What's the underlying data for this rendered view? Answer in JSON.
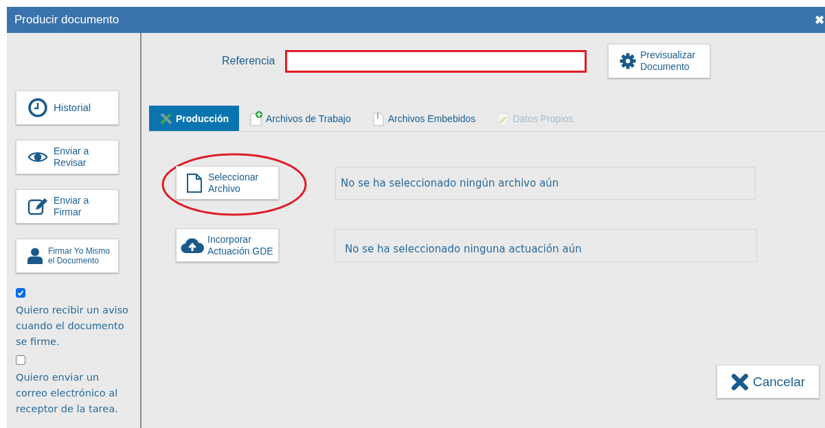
{
  "window": {
    "title": "Producir documento",
    "close": "✖"
  },
  "sidebar": {
    "buttons": [
      {
        "kind": "clock",
        "label": "Historial"
      },
      {
        "kind": "eye",
        "label": "Enviar a\nRevisar"
      },
      {
        "kind": "edit",
        "label": "Enviar a\nFirmar"
      },
      {
        "kind": "user",
        "label": "Firmar Yo Mismo\nel Documento"
      }
    ],
    "options": [
      {
        "checked": true,
        "label": "Quiero recibir un aviso cuando el documento se firme."
      },
      {
        "checked": false,
        "label": "Quiero enviar un correo electrónico al receptor de la tarea."
      }
    ]
  },
  "reference": {
    "label": "Referencia"
  },
  "preview_button": "Previsualizar\nDocumento",
  "tabs": [
    {
      "kind": "tools",
      "label": "Producción",
      "selected": true,
      "disabled": false
    },
    {
      "kind": "newdoc",
      "label": "Archivos de Trabajo",
      "selected": false,
      "disabled": false
    },
    {
      "kind": "clip",
      "label": "Archivos Embebidos",
      "selected": false,
      "disabled": false
    },
    {
      "kind": "pen",
      "label": "Datos Propios",
      "selected": false,
      "disabled": true
    }
  ],
  "actions": [
    {
      "kind": "file",
      "label": "Seleccionar\nArchivo",
      "status": "No se ha seleccionado ningún archivo aún",
      "highlighted": true
    },
    {
      "kind": "cloud",
      "label": "Incorporar\nActuación GDE",
      "status": "No se ha seleccionado ninguna actuación aún",
      "highlighted": false
    }
  ],
  "cancel_button": "Cancelar"
}
